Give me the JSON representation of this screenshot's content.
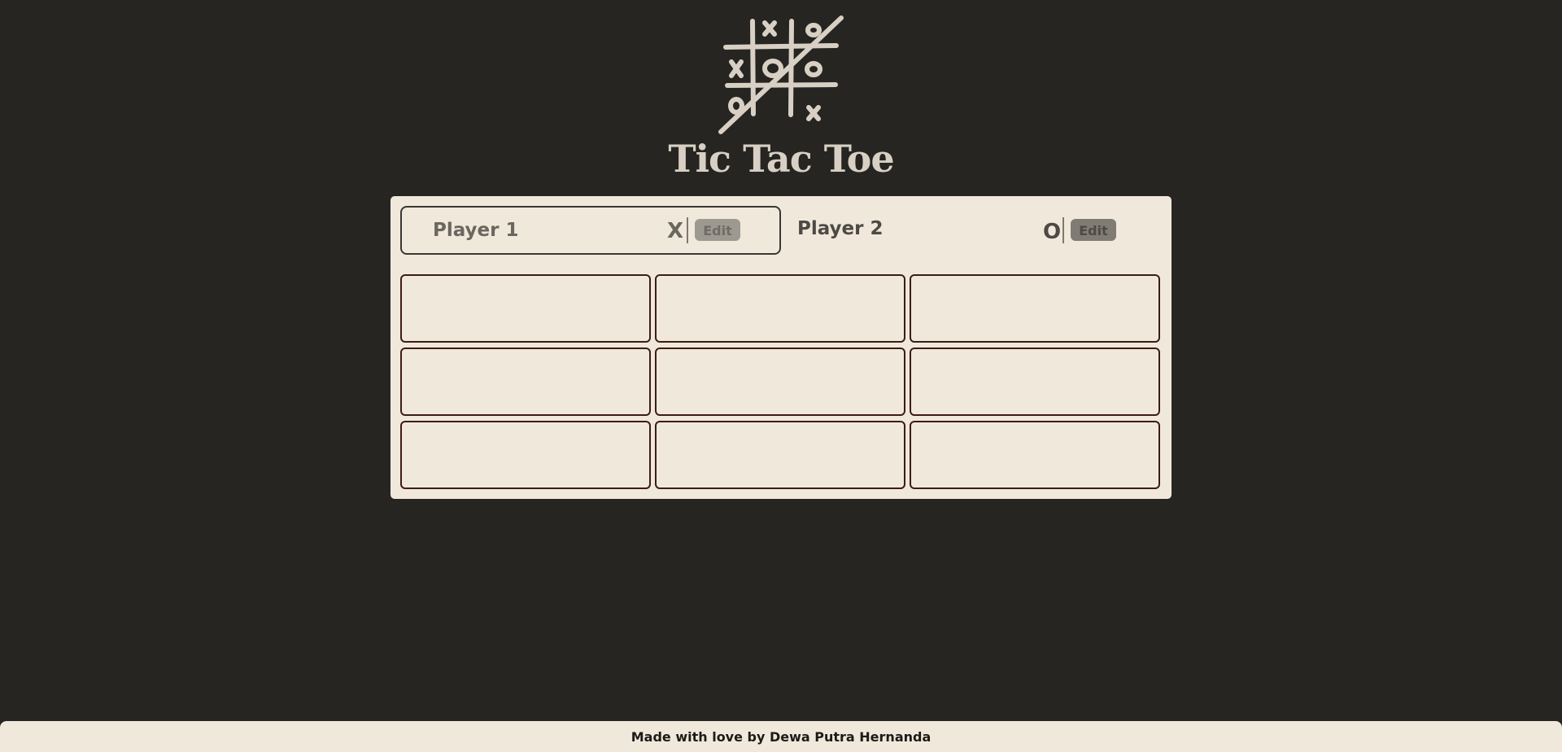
{
  "app": {
    "title": "Tic Tac Toe",
    "logo_icon": "tic-tac-toe-logo"
  },
  "players": [
    {
      "name": "Player 1",
      "symbol": "X",
      "edit_label": "Edit",
      "active": true
    },
    {
      "name": "Player 2",
      "symbol": "O",
      "edit_label": "Edit",
      "active": false
    }
  ],
  "board": {
    "cells": [
      "",
      "",
      "",
      "",
      "",
      "",
      "",
      "",
      ""
    ]
  },
  "footer": {
    "text": "Made with love by Dewa Putra Hernanda"
  },
  "colors": {
    "background": "#262521",
    "panel": "#f1e8dc",
    "cell_border": "#3b1d14",
    "title": "#d8d0c4"
  }
}
